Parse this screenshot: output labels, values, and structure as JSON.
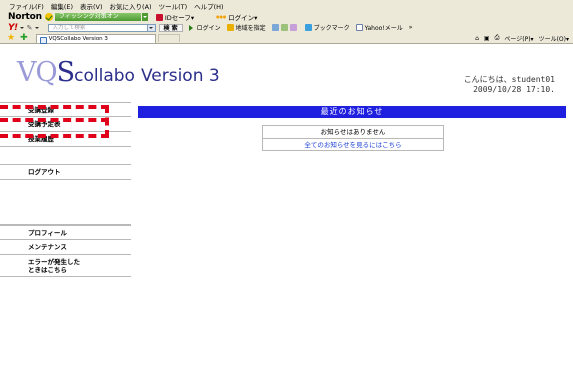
{
  "browser": {
    "menu": [
      "ファイル(F)",
      "編集(E)",
      "表示(V)",
      "お気に入り(A)",
      "ツール(T)",
      "ヘルプ(H)"
    ],
    "norton": {
      "brand": "Norton",
      "phishing_label": "フィッシング対策オン",
      "safe_label": "IDセーフ▾",
      "login_label": "ログイン▾"
    },
    "yahoo_bar": {
      "logo": "Y!",
      "search_placeholder": "入力して検索",
      "search_button": "検 索",
      "items": [
        "ログイン",
        "地域を指定",
        "ブックマーク",
        "Yahoo!メール"
      ],
      "more": "»"
    },
    "tabs": {
      "active_tab": "VQSCollabo Version 3",
      "right_tools": [
        "ページ(P)▾",
        "ツール(O)▾"
      ]
    }
  },
  "page": {
    "logo": {
      "vq": "VQ",
      "s": "S",
      "collabo": "collabo",
      "version": "Version 3"
    },
    "greeting_line1": "こんにちは、student01",
    "greeting_line2": "2009/10/28 17:10.",
    "sidebar": {
      "items": [
        {
          "label": "受講登録"
        },
        {
          "label": "受講予定表"
        },
        {
          "label": "授業履歴"
        },
        {
          "label": "ログアウト"
        },
        {
          "label": "プロフィール"
        },
        {
          "label": "メンテナンス"
        },
        {
          "label_line1": "エラーが発生した",
          "label_line2": "ときはこちら"
        }
      ]
    },
    "notices": {
      "header": "最近のお知らせ",
      "empty_message": "お知らせはありません",
      "all_link": "全てのお知らせを見るにはこちら"
    },
    "accent_colors": {
      "notice_bar": "#1f1fe0",
      "highlight_dash": "#e0001a",
      "link": "#1a3fd6"
    }
  }
}
